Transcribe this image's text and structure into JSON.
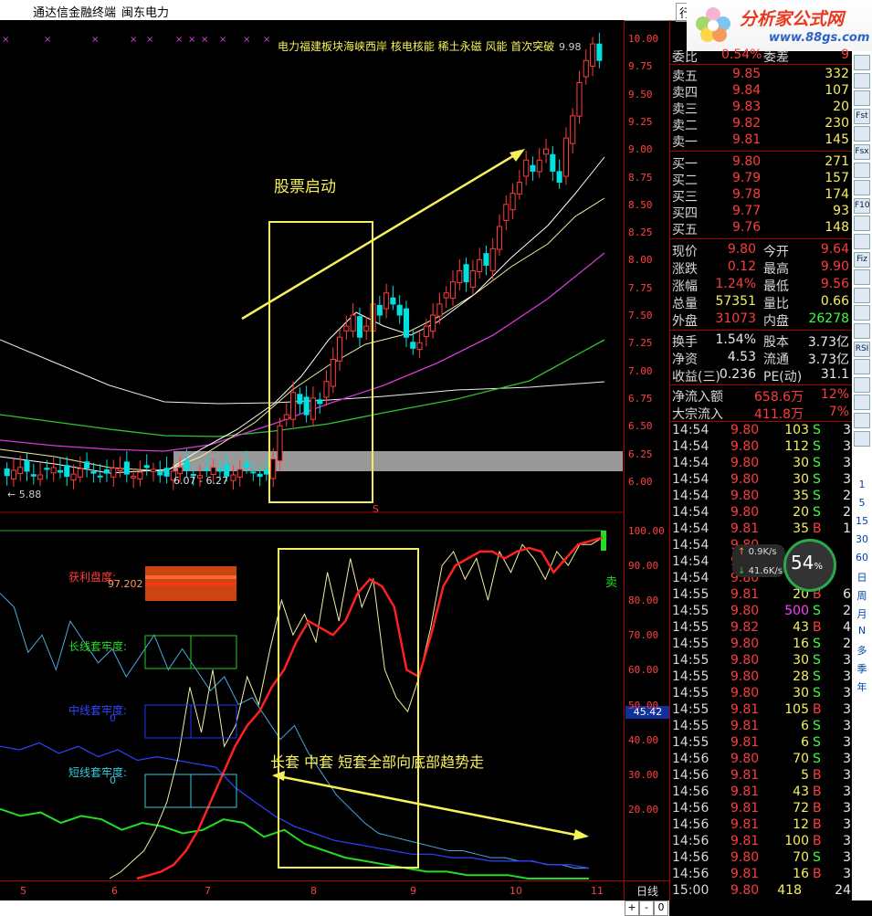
{
  "window": {
    "app_title": "通达信金融终端",
    "stock_name": "闽东电力",
    "menu_partial": "行"
  },
  "logo": {
    "brand": "分析家公式网",
    "url": "www.88gs.com"
  },
  "main_chart": {
    "concept_tags": "电力福建板块海峡西岸 核电核能 稀土永磁 风能 首次突破",
    "high_label": "9.98",
    "low_label": "5.88",
    "range_label": "6.07 - 6.27",
    "annotation_start": "股票启动",
    "sell_marker": "S",
    "y_ticks": [
      "10.00",
      "9.75",
      "9.50",
      "9.25",
      "9.00",
      "8.75",
      "8.50",
      "8.25",
      "8.00",
      "7.75",
      "7.50",
      "7.25",
      "7.00",
      "6.75",
      "6.50",
      "6.25",
      "6.00"
    ]
  },
  "indicator": {
    "profit_label": "获利盘度:",
    "profit_value": "97.202",
    "long_label": "长线套牢度:",
    "mid_label": "中线套牢度:",
    "mid_value": "0",
    "short_label": "短线套牢度:",
    "short_value": "0",
    "annotation_trend": "长套 中套 短套全部向底部趋势走",
    "sell_flag": "卖",
    "current_value": "45.42",
    "y_ticks": [
      "100.00",
      "90.00",
      "80.00",
      "70.00",
      "60.00",
      "50.00",
      "40.00",
      "30.00",
      "20.00"
    ]
  },
  "x_axis": {
    "labels": [
      "5",
      "6",
      "7",
      "8",
      "9",
      "10",
      "11"
    ],
    "period": "日线"
  },
  "quote": {
    "order_ratio": {
      "label": "委比",
      "value": "0.54%",
      "label2": "委差",
      "value2": "9"
    },
    "asks": [
      {
        "label": "卖五",
        "price": "9.85",
        "vol": "332"
      },
      {
        "label": "卖四",
        "price": "9.84",
        "vol": "107"
      },
      {
        "label": "卖三",
        "price": "9.83",
        "vol": "20"
      },
      {
        "label": "卖二",
        "price": "9.82",
        "vol": "230"
      },
      {
        "label": "卖一",
        "price": "9.81",
        "vol": "145"
      }
    ],
    "bids": [
      {
        "label": "买一",
        "price": "9.80",
        "vol": "271"
      },
      {
        "label": "买二",
        "price": "9.79",
        "vol": "157"
      },
      {
        "label": "买三",
        "price": "9.78",
        "vol": "174"
      },
      {
        "label": "买四",
        "price": "9.77",
        "vol": "93"
      },
      {
        "label": "买五",
        "price": "9.76",
        "vol": "148"
      }
    ],
    "stats": [
      {
        "l1": "现价",
        "v1": "9.80",
        "c1": "red",
        "l2": "今开",
        "v2": "9.64",
        "c2": "red"
      },
      {
        "l1": "涨跌",
        "v1": "0.12",
        "c1": "red",
        "l2": "最高",
        "v2": "9.90",
        "c2": "red"
      },
      {
        "l1": "涨幅",
        "v1": "1.24%",
        "c1": "red",
        "l2": "最低",
        "v2": "9.56",
        "c2": "red"
      },
      {
        "l1": "总量",
        "v1": "57351",
        "c1": "yel",
        "l2": "量比",
        "v2": "0.66",
        "c2": "yel"
      },
      {
        "l1": "外盘",
        "v1": "31073",
        "c1": "red",
        "l2": "内盘",
        "v2": "26278",
        "c2": "grn"
      }
    ],
    "fundamentals": [
      {
        "l1": "换手",
        "v1": "1.54%",
        "l2": "股本",
        "v2": "3.73亿"
      },
      {
        "l1": "净资",
        "v1": "4.53",
        "l2": "流通",
        "v2": "3.73亿"
      },
      {
        "l1": "收益(三)",
        "v1": "0.236",
        "l2": "PE(动)",
        "v2": "31.1"
      }
    ],
    "flows": [
      {
        "label": "净流入额",
        "value": "658.6万",
        "pct": "12%"
      },
      {
        "label": "大宗流入",
        "value": "411.8万",
        "pct": "7%"
      }
    ],
    "ticks": [
      {
        "t": "14:54",
        "p": "9.80",
        "v": "103",
        "s": "S",
        "n": "3"
      },
      {
        "t": "14:54",
        "p": "9.80",
        "v": "112",
        "s": "S",
        "n": "3"
      },
      {
        "t": "14:54",
        "p": "9.80",
        "v": "30",
        "s": "S",
        "n": "3"
      },
      {
        "t": "14:54",
        "p": "9.80",
        "v": "30",
        "s": "S",
        "n": "3"
      },
      {
        "t": "14:54",
        "p": "9.80",
        "v": "35",
        "s": "S",
        "n": "2"
      },
      {
        "t": "14:54",
        "p": "9.80",
        "v": "20",
        "s": "S",
        "n": "2"
      },
      {
        "t": "14:54",
        "p": "9.81",
        "v": "35",
        "s": "B",
        "n": "1"
      },
      {
        "t": "14:54",
        "p": "9.80",
        "v": "",
        "s": "",
        "n": ""
      },
      {
        "t": "14:54",
        "p": "9.80",
        "v": "",
        "s": "",
        "n": ""
      },
      {
        "t": "14:54",
        "p": "9.80",
        "v": "",
        "s": "",
        "n": ""
      },
      {
        "t": "14:55",
        "p": "9.81",
        "v": "20",
        "s": "B",
        "n": "6"
      },
      {
        "t": "14:55",
        "p": "9.80",
        "v": "500",
        "s": "S",
        "n": "2"
      },
      {
        "t": "14:55",
        "p": "9.82",
        "v": "43",
        "s": "B",
        "n": "4"
      },
      {
        "t": "14:55",
        "p": "9.80",
        "v": "16",
        "s": "S",
        "n": "2"
      },
      {
        "t": "14:55",
        "p": "9.80",
        "v": "30",
        "s": "S",
        "n": "3"
      },
      {
        "t": "14:55",
        "p": "9.80",
        "v": "28",
        "s": "S",
        "n": "3"
      },
      {
        "t": "14:55",
        "p": "9.80",
        "v": "30",
        "s": "S",
        "n": "3"
      },
      {
        "t": "14:55",
        "p": "9.81",
        "v": "105",
        "s": "B",
        "n": "3"
      },
      {
        "t": "14:55",
        "p": "9.81",
        "v": "6",
        "s": "S",
        "n": "3"
      },
      {
        "t": "14:55",
        "p": "9.81",
        "v": "6",
        "s": "S",
        "n": "3"
      },
      {
        "t": "14:56",
        "p": "9.80",
        "v": "70",
        "s": "S",
        "n": "3"
      },
      {
        "t": "14:56",
        "p": "9.81",
        "v": "5",
        "s": "B",
        "n": "3"
      },
      {
        "t": "14:56",
        "p": "9.81",
        "v": "43",
        "s": "B",
        "n": "3"
      },
      {
        "t": "14:56",
        "p": "9.81",
        "v": "72",
        "s": "B",
        "n": "3"
      },
      {
        "t": "14:56",
        "p": "9.81",
        "v": "12",
        "s": "B",
        "n": "3"
      },
      {
        "t": "14:56",
        "p": "9.81",
        "v": "100",
        "s": "B",
        "n": "3"
      },
      {
        "t": "14:56",
        "p": "9.80",
        "v": "70",
        "s": "S",
        "n": "3"
      },
      {
        "t": "14:56",
        "p": "9.81",
        "v": "16",
        "s": "B",
        "n": "3"
      },
      {
        "t": "15:00",
        "p": "9.80",
        "v": "418",
        "s": "",
        "n": "24"
      }
    ]
  },
  "speed_widget": {
    "percent": "54",
    "up": "0.9K/s",
    "down": "41.6K/s"
  },
  "side_tabs": [
    "1",
    "5",
    "15",
    "30",
    "60",
    "日",
    "周",
    "月",
    "N",
    "多",
    "季",
    "年"
  ],
  "side_icons": [
    "Fst",
    "Fsx",
    "F10",
    "Fiz",
    "RSI"
  ],
  "bottom_controls": {
    "plus": "+",
    "minus": "-",
    "zero": "0"
  }
}
